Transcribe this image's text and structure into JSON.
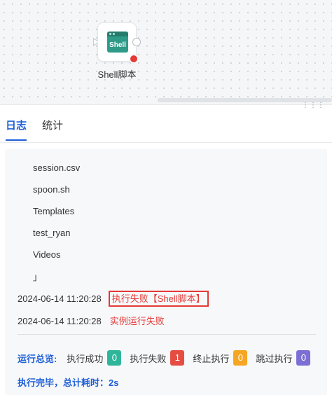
{
  "canvas": {
    "node": {
      "icon_text": "Shell",
      "label": "Shell脚本"
    }
  },
  "tabs": [
    {
      "label": "日志",
      "active": true
    },
    {
      "label": "统计",
      "active": false
    }
  ],
  "log": {
    "lines": [
      "session.csv",
      "spoon.sh",
      "Templates",
      "test_ryan",
      "Videos",
      "」"
    ],
    "entries": [
      {
        "timestamp": "2024-06-14 11:20:28",
        "message": "执行失败【Shell脚本】",
        "highlighted": true
      },
      {
        "timestamp": "2024-06-14 11:20:28",
        "message": "实例运行失败",
        "highlighted": false
      }
    ],
    "summary": {
      "title": "运行总览:",
      "items": [
        {
          "label": "执行成功",
          "count": "0",
          "color": "#2fb59a"
        },
        {
          "label": "执行失败",
          "count": "1",
          "color": "#e54d42"
        },
        {
          "label": "终止执行",
          "count": "0",
          "color": "#f5a623"
        },
        {
          "label": "跳过执行",
          "count": "0",
          "color": "#7b6fd6"
        }
      ]
    },
    "footer": "执行完毕，总计耗时：2s"
  },
  "colors": {
    "accent": "#1f5fd6",
    "error": "#e53935",
    "node_icon": "#2f9a87"
  }
}
